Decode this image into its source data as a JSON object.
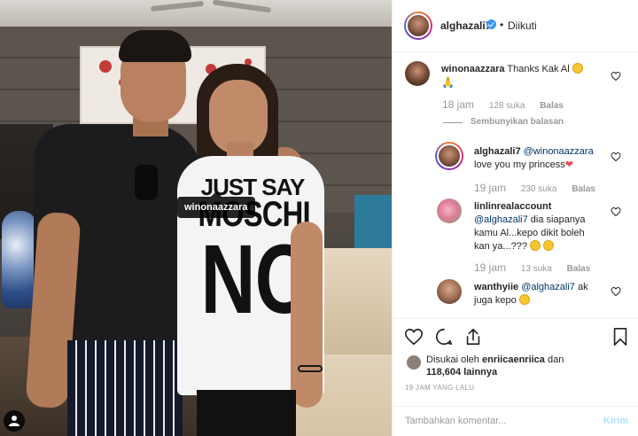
{
  "photo": {
    "tag_label": "winonaazzara",
    "shirt_line1": "JUST SAY",
    "shirt_line2": "MOSCHI",
    "shirt_line3": "NO"
  },
  "header": {
    "username": "alghazali7",
    "dot": "•",
    "follow_status": "Diikuti"
  },
  "comments": [
    {
      "username": "winonaazzara",
      "text": "Thanks Kak Al",
      "time": "18 jam",
      "likes": "128 suka",
      "reply": "Balas",
      "hide_replies": "Sembunyikan balasan"
    },
    {
      "username": "alghazali7",
      "mention": "@winonaazzara",
      "text": "love you my princess",
      "time": "19 jam",
      "likes": "230 suka",
      "reply": "Balas"
    },
    {
      "username": "linlinrealaccount",
      "mention": "@alghazali7",
      "text": "dia siapanya kamu Al...kepo dikit boleh kan ya...???",
      "time": "19 jam",
      "likes": "13 suka",
      "reply": "Balas"
    },
    {
      "username": "wanthyiie",
      "mention": "@alghazali7",
      "text": "ak juga kepo"
    }
  ],
  "likes_info": {
    "prefix": "Disukai oleh",
    "liker": "enriicaenriica",
    "conj": "dan",
    "count": "118,604 lainnya"
  },
  "timeago": "19 JAM YANG LALU",
  "comment_box": {
    "placeholder": "Tambahkan komentar...",
    "post_label": "Kirim"
  },
  "icons": [
    "heart-icon",
    "comment-icon",
    "share-icon",
    "bookmark-icon",
    "user-tag-icon",
    "verified-badge-icon"
  ],
  "colors": {
    "link": "#003569",
    "verified": "#3897f0",
    "muted": "#999999",
    "post_disabled": "#b2dffc",
    "heart": "#ed4956"
  }
}
